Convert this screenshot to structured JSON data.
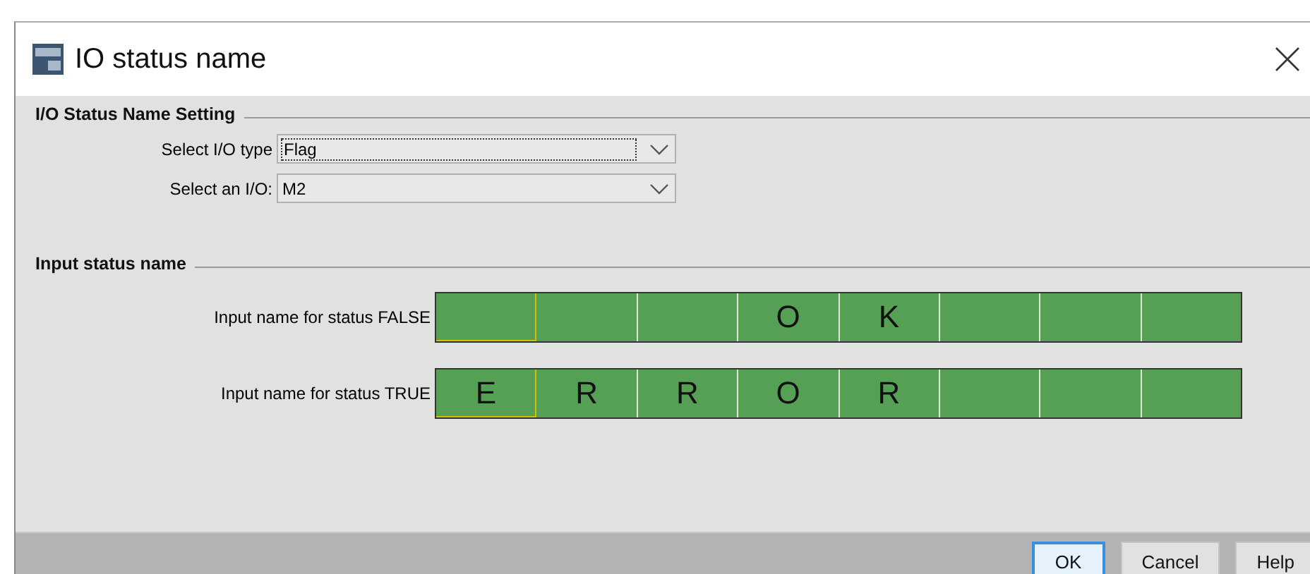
{
  "window": {
    "title": "IO status name"
  },
  "io_section": {
    "heading": "I/O Status Name Setting",
    "fields": [
      {
        "label": "Select I/O type",
        "value": "Flag",
        "focused": true
      },
      {
        "label": "Select an I/O:",
        "value": "M2",
        "focused": false
      }
    ]
  },
  "status_section": {
    "heading": "Input status name",
    "rows": [
      {
        "label": "Input name for status FALSE",
        "cells": [
          {
            "selected": true
          },
          {
            "selected": false
          },
          {
            "selected": false
          },
          {
            "char": "O",
            "selected": false
          },
          {
            "char": "K",
            "selected": false
          },
          {
            "selected": false
          },
          {
            "selected": false
          },
          {
            "selected": false
          }
        ]
      },
      {
        "label": "Input name for status TRUE",
        "cells": [
          {
            "char": "E",
            "selected": true
          },
          {
            "char": "R",
            "selected": false
          },
          {
            "char": "R",
            "selected": false
          },
          {
            "char": "O",
            "selected": false
          },
          {
            "char": "R",
            "selected": false
          },
          {
            "selected": false
          },
          {
            "selected": false
          },
          {
            "selected": false
          }
        ]
      }
    ]
  },
  "buttons": [
    {
      "label": "OK",
      "default": true
    },
    {
      "label": "Cancel",
      "default": false
    },
    {
      "label": "Help",
      "default": false
    }
  ]
}
